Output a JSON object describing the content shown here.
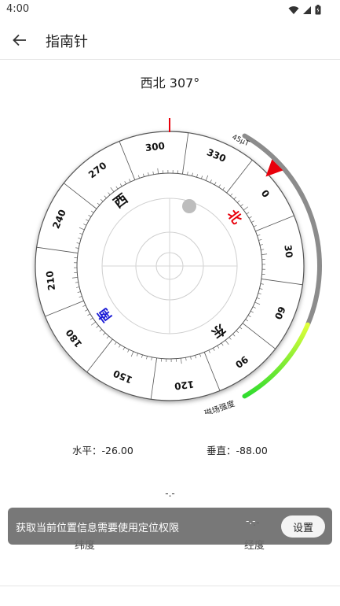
{
  "status_bar": {
    "time": "4:00"
  },
  "app_bar": {
    "title": "指南针"
  },
  "heading": "西北 307°",
  "compass": {
    "heading_deg": 307,
    "dial_labels": [
      "0",
      "30",
      "60",
      "90",
      "120",
      "150",
      "180",
      "210",
      "240",
      "270",
      "300",
      "330"
    ],
    "cardinals": {
      "north": "北",
      "east": "东",
      "south": "南",
      "west": "西"
    },
    "cardinal_colors": {
      "north": "#e8000b",
      "south": "#1b1bd6",
      "east": "#111111",
      "west": "#111111"
    },
    "gauge_top_label": "45μT",
    "gauge_bottom_label": "磁场强度",
    "pointer_color": "#e8000b"
  },
  "readings": {
    "horizontal": "水平：-26.00",
    "vertical": "垂直：-88.00"
  },
  "location": {
    "center_value": "-.-",
    "latitude_value": "-.-",
    "latitude_label": "纬度",
    "longitude_value": "-.-",
    "longitude_label": "经度"
  },
  "snackbar": {
    "message": "获取当前位置信息需要使用定位权限",
    "action": "设置"
  }
}
